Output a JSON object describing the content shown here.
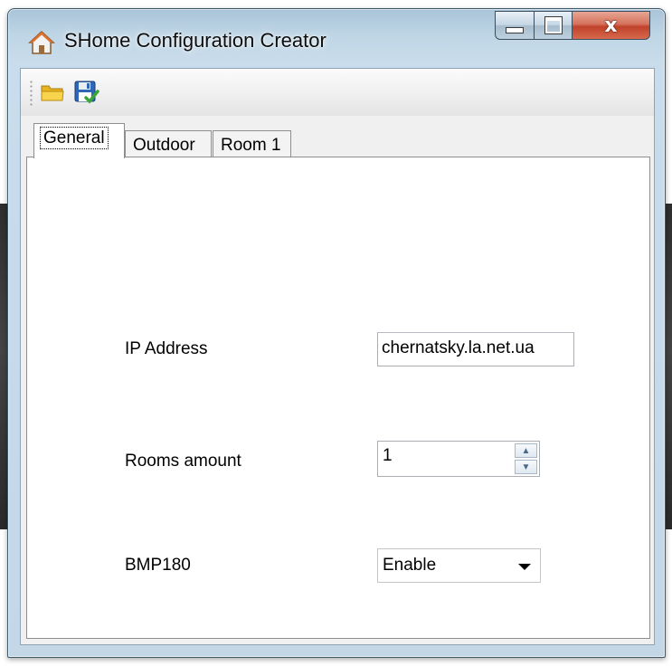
{
  "window": {
    "title": "SHome Configuration Creator",
    "icon": "house-icon",
    "caption_buttons": {
      "minimize": "minimize-icon",
      "maximize": "maximize-icon",
      "close_label": "x"
    }
  },
  "toolbar": {
    "buttons": [
      {
        "name": "open",
        "icon": "folder-open-icon"
      },
      {
        "name": "save",
        "icon": "floppy-save-icon"
      }
    ]
  },
  "tabs": [
    {
      "label": "General",
      "selected": true
    },
    {
      "label": "Outdoor",
      "selected": false
    },
    {
      "label": "Room 1",
      "selected": false
    }
  ],
  "general": {
    "ip_address_label": "IP Address",
    "ip_address_value": "chernatsky.la.net.ua",
    "rooms_amount_label": "Rooms amount",
    "rooms_amount_value": "1",
    "bmp180_label": "BMP180",
    "bmp180_value": "Enable"
  },
  "colors": {
    "close_button": "#c7462f",
    "title_glass": "#bfd6e6"
  }
}
